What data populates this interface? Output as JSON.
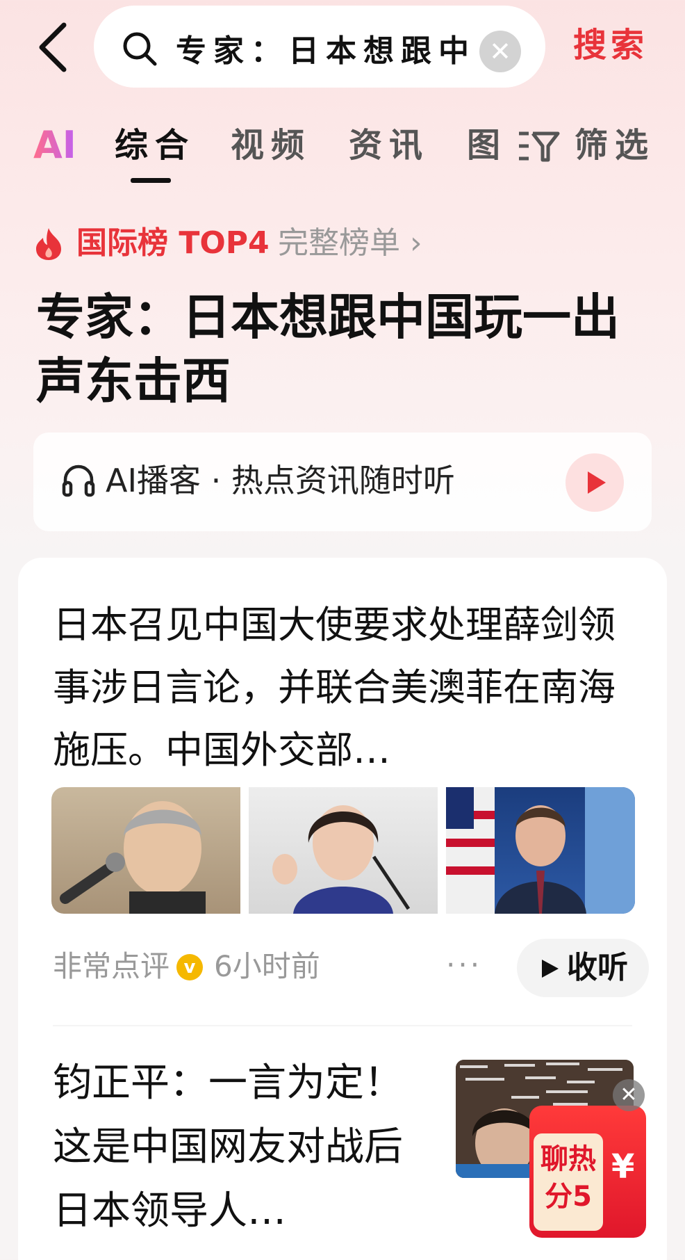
{
  "search": {
    "query": "专家：日本想跟中",
    "clear_label": "✕",
    "button_label": "搜索"
  },
  "tabs": [
    {
      "label": "AI"
    },
    {
      "label": "综合",
      "active": true
    },
    {
      "label": "视频"
    },
    {
      "label": "资讯"
    },
    {
      "label": "图"
    }
  ],
  "filter_label": "筛选",
  "hot_rank": {
    "label": "国际榜 TOP4",
    "full_list": "完整榜单 ›"
  },
  "headline": "专家：日本想跟中国玩一出声东击西",
  "podcast": {
    "text": "AI播客 · 热点资讯随时听"
  },
  "article1": {
    "title": "日本召见中国大使要求处理薛剑领事涉日言论，并联合美澳菲在南海施压。中国外交部…",
    "source": "非常点评",
    "verified": "v",
    "time": "6小时前",
    "more": "···",
    "listen_label": "收听"
  },
  "article2": {
    "title": "钧正平：一言为定！这是中国网友对战后日本领导人…"
  },
  "redpack": {
    "text_line1": "聊热",
    "text_line2": "分5",
    "currency": "¥",
    "close": "✕"
  },
  "colors": {
    "accent_red": "#e8333a",
    "tab_active": "#111111",
    "muted": "#999999"
  }
}
